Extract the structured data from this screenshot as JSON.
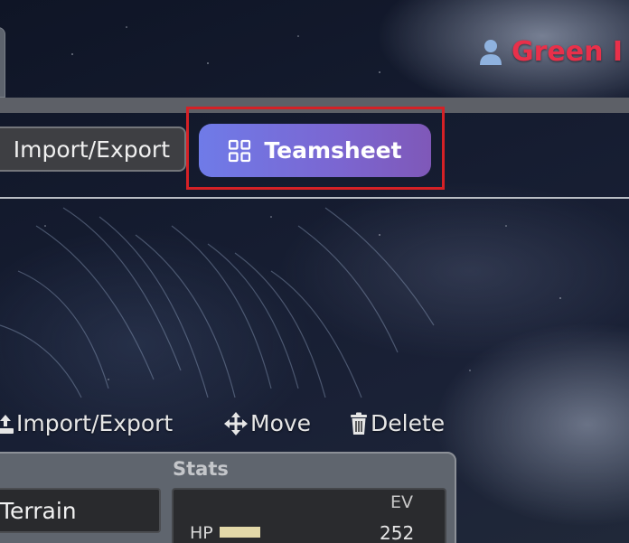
{
  "header": {
    "username": "Green I",
    "user_icon": "user-icon"
  },
  "toolbar": {
    "import_export_label": "Import/Export",
    "teamsheet_label": "Teamsheet",
    "teamsheet_icon": "grid-icon",
    "highlight_color": "#d52126",
    "teamsheet_gradient": [
      "#6f7be8",
      "#7f58b8"
    ]
  },
  "pokemon_actions": {
    "import_export_label": "Import/Export",
    "move_label": "Move",
    "delete_label": "Delete"
  },
  "details": {
    "ability_value": "Terrain"
  },
  "stats": {
    "heading": "Stats",
    "ev_column": "EV",
    "rows": [
      {
        "label": "HP",
        "ev": "252",
        "bar_fraction": 0.5
      }
    ]
  },
  "colors": {
    "username": "#e8304a",
    "hp_bar": "#e3d9a9"
  }
}
